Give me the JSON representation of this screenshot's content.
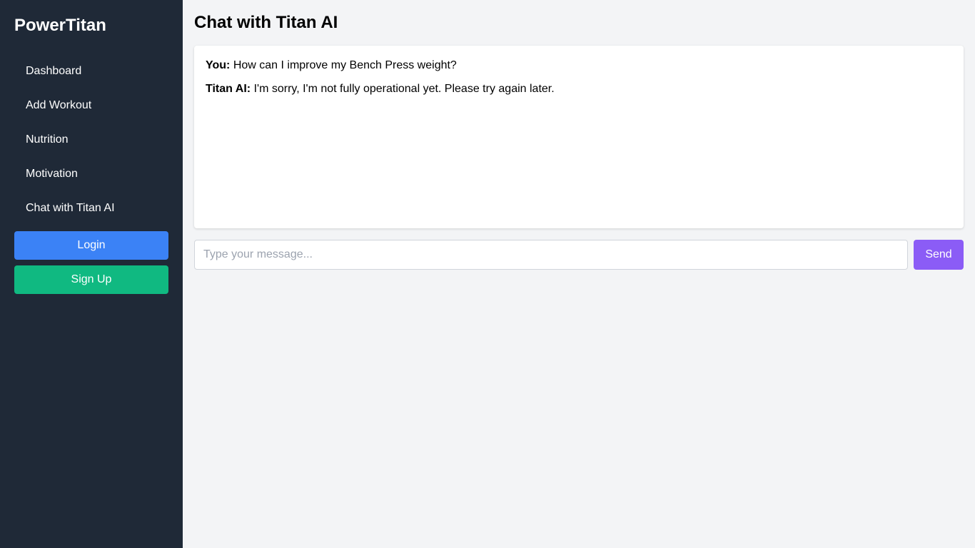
{
  "sidebar": {
    "brand": "PowerTitan",
    "items": [
      {
        "label": "Dashboard"
      },
      {
        "label": "Add Workout"
      },
      {
        "label": "Nutrition"
      },
      {
        "label": "Motivation"
      },
      {
        "label": "Chat with Titan AI"
      }
    ],
    "login_label": "Login",
    "signup_label": "Sign Up"
  },
  "main": {
    "title": "Chat with Titan AI",
    "messages": [
      {
        "sender": "You:",
        "text": "How can I improve my Bench Press weight?"
      },
      {
        "sender": "Titan AI:",
        "text": "I'm sorry, I'm not fully operational yet. Please try again later."
      }
    ],
    "input": {
      "value": "",
      "placeholder": "Type your message..."
    },
    "send_label": "Send"
  },
  "colors": {
    "sidebar_bg": "#1f2937",
    "page_bg": "#f3f4f6",
    "login": "#3b82f6",
    "signup": "#10b981",
    "send": "#8b5cf6"
  }
}
